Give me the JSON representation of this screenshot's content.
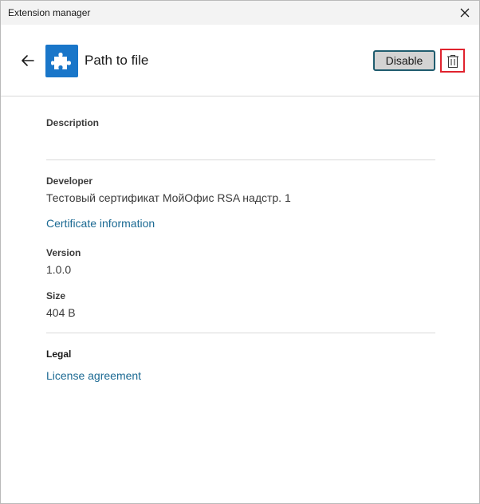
{
  "window": {
    "title": "Extension manager"
  },
  "header": {
    "extension_name": "Path to file",
    "disable_label": "Disable"
  },
  "description": {
    "label": "Description",
    "value": ""
  },
  "developer": {
    "label": "Developer",
    "value": "Тестовый сертификат МойОфис RSA надстр. 1",
    "certificate_link": "Certificate information"
  },
  "version": {
    "label": "Version",
    "value": "1.0.0"
  },
  "size": {
    "label": "Size",
    "value": "404 B"
  },
  "legal": {
    "label": "Legal",
    "license_link": "License agreement"
  },
  "icons": {
    "back": "back-arrow-icon",
    "close": "close-icon",
    "extension": "puzzle-piece-icon",
    "delete": "trash-icon"
  },
  "colors": {
    "accent": "#1976c9",
    "link": "#1c6a93",
    "focus_outline": "#e0232e",
    "button_border": "#1f5c6e"
  }
}
